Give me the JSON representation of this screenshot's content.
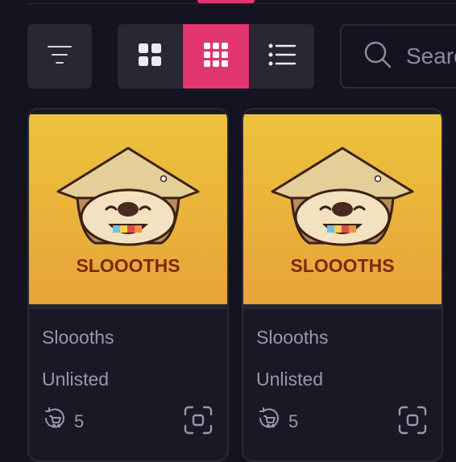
{
  "toolbar": {
    "filter_icon": "filter-lines-icon",
    "views": [
      {
        "icon": "grid-large-icon",
        "active": false
      },
      {
        "icon": "grid-small-icon",
        "active": true
      },
      {
        "icon": "list-icon",
        "active": false
      }
    ],
    "search_placeholder": "Searc"
  },
  "colors": {
    "accent": "#e0356f",
    "background": "#161320",
    "card": "#1b1826"
  },
  "cards": [
    {
      "logo_text": "SLOOOTHS",
      "name": "Sloooths",
      "status": "Unlisted",
      "count": "5"
    },
    {
      "logo_text": "SLOOOTHS",
      "name": "Sloooths",
      "status": "Unlisted",
      "count": "5"
    }
  ]
}
